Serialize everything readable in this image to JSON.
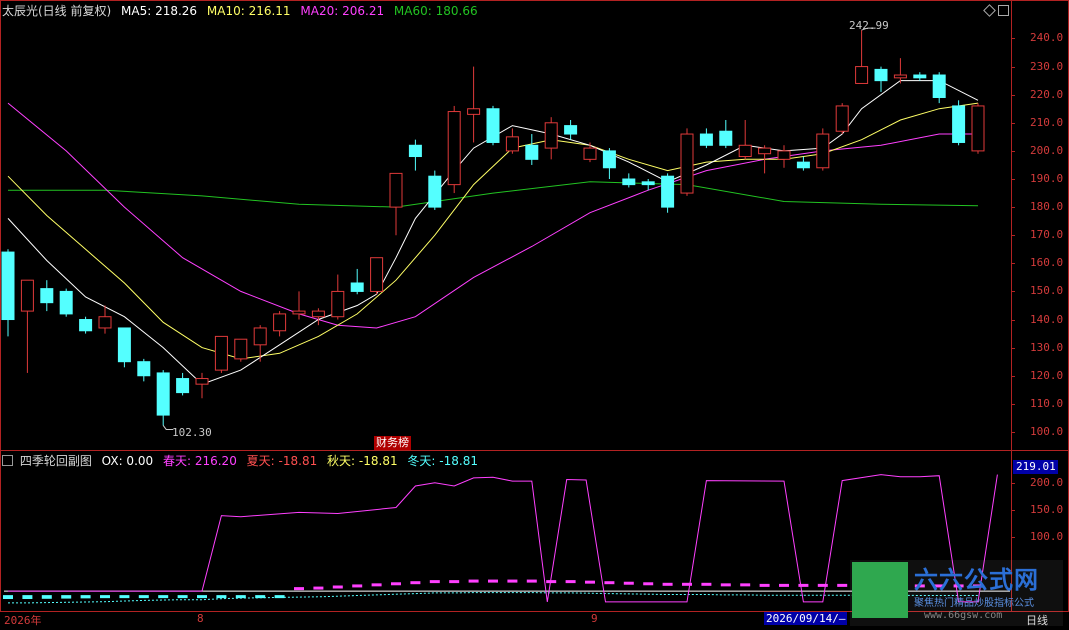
{
  "main_header": {
    "title": "太辰光(日线 前复权)",
    "ma5": "MA5: 218.26",
    "ma10": "MA10: 216.11",
    "ma20": "MA20: 206.21",
    "ma60": "MA60: 180.66"
  },
  "colors": {
    "up": "#e03a3a",
    "down": "#54ffff",
    "ma5": "#ffffff",
    "ma10": "#ffff66",
    "ma20": "#ff40ff",
    "ma60": "#22c322",
    "axis": "#b22222"
  },
  "main_axis_labels": [
    "240.0",
    "230.0",
    "220.0",
    "210.0",
    "200.0",
    "190.0",
    "180.0",
    "170.0",
    "160.0",
    "150.0",
    "140.0",
    "130.0",
    "120.0",
    "110.0",
    "100.0"
  ],
  "annotations": {
    "high": "242.99",
    "low": "102.30",
    "news_tag": "财务榜"
  },
  "top_right_icons": [
    "diamond-icon",
    "square-icon"
  ],
  "sub_header": {
    "title": "四季轮回副图",
    "ox": "OX: 0.00",
    "spring": "春天: 216.20",
    "summer": "夏天: -18.81",
    "autumn": "秋天: -18.81",
    "winter": "冬天: -18.81"
  },
  "sub_axis_labels": [
    "200.0",
    "150.0",
    "100.0"
  ],
  "sub_current_value": "219.01",
  "x_axis": {
    "year": "2026年",
    "m1": "8",
    "m2": "9",
    "cursor_date": "2026/09/14/—",
    "period": "日线"
  },
  "watermark": {
    "brand": "六六公式网",
    "slogan": "聚焦热门精品炒股指标公式",
    "url": "www.66gsw.com"
  },
  "chart_data": {
    "type": "candlestick",
    "price_range": [
      95,
      248
    ],
    "candles": [
      {
        "o": 164,
        "c": 140,
        "h": 165,
        "l": 134
      },
      {
        "o": 143,
        "c": 154,
        "h": 154,
        "l": 121
      },
      {
        "o": 151,
        "c": 146,
        "h": 154,
        "l": 143
      },
      {
        "o": 150,
        "c": 142,
        "h": 151,
        "l": 141
      },
      {
        "o": 140,
        "c": 136,
        "h": 141,
        "l": 135
      },
      {
        "o": 137,
        "c": 141,
        "h": 145,
        "l": 135
      },
      {
        "o": 137,
        "c": 125,
        "h": 137,
        "l": 123
      },
      {
        "o": 125,
        "c": 120,
        "h": 126,
        "l": 118
      },
      {
        "o": 121,
        "c": 106,
        "h": 122,
        "l": 102.3
      },
      {
        "o": 119,
        "c": 114,
        "h": 121,
        "l": 113
      },
      {
        "o": 117,
        "c": 119,
        "h": 121,
        "l": 112
      },
      {
        "o": 122,
        "c": 134,
        "h": 134,
        "l": 121
      },
      {
        "o": 126,
        "c": 133,
        "h": 133,
        "l": 125
      },
      {
        "o": 131,
        "c": 137,
        "h": 138,
        "l": 125
      },
      {
        "o": 136,
        "c": 142,
        "h": 143,
        "l": 134
      },
      {
        "o": 142,
        "c": 143,
        "h": 150,
        "l": 140
      },
      {
        "o": 141,
        "c": 143,
        "h": 144,
        "l": 138
      },
      {
        "o": 141,
        "c": 150,
        "h": 156,
        "l": 140
      },
      {
        "o": 153,
        "c": 150,
        "h": 158,
        "l": 149
      },
      {
        "o": 150,
        "c": 162,
        "h": 162,
        "l": 149
      },
      {
        "o": 180,
        "c": 192,
        "h": 192,
        "l": 170
      },
      {
        "o": 202,
        "c": 198,
        "h": 204,
        "l": 193
      },
      {
        "o": 191,
        "c": 180,
        "h": 193,
        "l": 179
      },
      {
        "o": 188,
        "c": 214,
        "h": 216,
        "l": 185
      },
      {
        "o": 213,
        "c": 215,
        "h": 230,
        "l": 203
      },
      {
        "o": 215,
        "c": 203,
        "h": 216,
        "l": 202
      },
      {
        "o": 200,
        "c": 205,
        "h": 208,
        "l": 199
      },
      {
        "o": 202,
        "c": 197,
        "h": 206,
        "l": 195
      },
      {
        "o": 201,
        "c": 210,
        "h": 212,
        "l": 197
      },
      {
        "o": 209,
        "c": 206,
        "h": 211,
        "l": 204
      },
      {
        "o": 197,
        "c": 201,
        "h": 203,
        "l": 196
      },
      {
        "o": 200,
        "c": 194,
        "h": 201,
        "l": 190
      },
      {
        "o": 190,
        "c": 188,
        "h": 192,
        "l": 187
      },
      {
        "o": 189,
        "c": 188,
        "h": 190,
        "l": 186
      },
      {
        "o": 191,
        "c": 180,
        "h": 192,
        "l": 178
      },
      {
        "o": 185,
        "c": 206,
        "h": 208,
        "l": 184
      },
      {
        "o": 206,
        "c": 202,
        "h": 208,
        "l": 201
      },
      {
        "o": 207,
        "c": 202,
        "h": 211,
        "l": 201
      },
      {
        "o": 198,
        "c": 202,
        "h": 211,
        "l": 197
      },
      {
        "o": 199,
        "c": 201,
        "h": 202,
        "l": 192
      },
      {
        "o": 197,
        "c": 200,
        "h": 202,
        "l": 194
      },
      {
        "o": 196,
        "c": 194,
        "h": 198,
        "l": 193
      },
      {
        "o": 194,
        "c": 206,
        "h": 208,
        "l": 193
      },
      {
        "o": 207,
        "c": 216,
        "h": 217,
        "l": 206
      },
      {
        "o": 224,
        "c": 230,
        "h": 242.99,
        "l": 224
      },
      {
        "o": 229,
        "c": 225,
        "h": 230,
        "l": 221
      },
      {
        "o": 226,
        "c": 227,
        "h": 233,
        "l": 224
      },
      {
        "o": 227,
        "c": 226,
        "h": 228,
        "l": 225
      },
      {
        "o": 227,
        "c": 219,
        "h": 228,
        "l": 217
      },
      {
        "o": 216,
        "c": 203,
        "h": 218,
        "l": 202
      },
      {
        "o": 200,
        "c": 216,
        "h": 217,
        "l": 199
      }
    ],
    "ma5": [
      {
        "i": 0,
        "v": 176
      },
      {
        "i": 2,
        "v": 161
      },
      {
        "i": 4,
        "v": 148
      },
      {
        "i": 6,
        "v": 141
      },
      {
        "i": 8,
        "v": 130
      },
      {
        "i": 10,
        "v": 117
      },
      {
        "i": 12,
        "v": 122
      },
      {
        "i": 14,
        "v": 131
      },
      {
        "i": 16,
        "v": 140
      },
      {
        "i": 18,
        "v": 145
      },
      {
        "i": 19,
        "v": 149
      },
      {
        "i": 20,
        "v": 162
      },
      {
        "i": 21,
        "v": 176
      },
      {
        "i": 23,
        "v": 193
      },
      {
        "i": 24,
        "v": 201
      },
      {
        "i": 26,
        "v": 209
      },
      {
        "i": 28,
        "v": 206
      },
      {
        "i": 30,
        "v": 202
      },
      {
        "i": 32,
        "v": 196
      },
      {
        "i": 34,
        "v": 189
      },
      {
        "i": 36,
        "v": 195
      },
      {
        "i": 38,
        "v": 202
      },
      {
        "i": 40,
        "v": 200
      },
      {
        "i": 42,
        "v": 201
      },
      {
        "i": 43,
        "v": 206
      },
      {
        "i": 44,
        "v": 215
      },
      {
        "i": 46,
        "v": 225
      },
      {
        "i": 48,
        "v": 225
      },
      {
        "i": 50,
        "v": 218
      }
    ],
    "ma10": [
      {
        "i": 0,
        "v": 191
      },
      {
        "i": 2,
        "v": 177
      },
      {
        "i": 4,
        "v": 165
      },
      {
        "i": 6,
        "v": 153
      },
      {
        "i": 8,
        "v": 139
      },
      {
        "i": 10,
        "v": 130
      },
      {
        "i": 12,
        "v": 126
      },
      {
        "i": 14,
        "v": 128
      },
      {
        "i": 16,
        "v": 134
      },
      {
        "i": 18,
        "v": 142
      },
      {
        "i": 20,
        "v": 154
      },
      {
        "i": 22,
        "v": 170
      },
      {
        "i": 24,
        "v": 188
      },
      {
        "i": 26,
        "v": 201
      },
      {
        "i": 28,
        "v": 204
      },
      {
        "i": 30,
        "v": 202
      },
      {
        "i": 32,
        "v": 197
      },
      {
        "i": 34,
        "v": 193
      },
      {
        "i": 36,
        "v": 196
      },
      {
        "i": 38,
        "v": 197
      },
      {
        "i": 40,
        "v": 197
      },
      {
        "i": 42,
        "v": 199
      },
      {
        "i": 44,
        "v": 204
      },
      {
        "i": 46,
        "v": 211
      },
      {
        "i": 48,
        "v": 215
      },
      {
        "i": 50,
        "v": 217
      }
    ],
    "ma20": [
      {
        "i": 0,
        "v": 217
      },
      {
        "i": 3,
        "v": 200
      },
      {
        "i": 6,
        "v": 180
      },
      {
        "i": 9,
        "v": 162
      },
      {
        "i": 12,
        "v": 150
      },
      {
        "i": 15,
        "v": 142
      },
      {
        "i": 17,
        "v": 138
      },
      {
        "i": 19,
        "v": 137
      },
      {
        "i": 21,
        "v": 141
      },
      {
        "i": 24,
        "v": 155
      },
      {
        "i": 27,
        "v": 166
      },
      {
        "i": 30,
        "v": 178
      },
      {
        "i": 33,
        "v": 186
      },
      {
        "i": 36,
        "v": 193
      },
      {
        "i": 39,
        "v": 197
      },
      {
        "i": 42,
        "v": 200
      },
      {
        "i": 45,
        "v": 202
      },
      {
        "i": 48,
        "v": 206
      },
      {
        "i": 50,
        "v": 206
      }
    ],
    "ma60": [
      {
        "i": 0,
        "v": 186
      },
      {
        "i": 5,
        "v": 186
      },
      {
        "i": 10,
        "v": 184
      },
      {
        "i": 15,
        "v": 181
      },
      {
        "i": 20,
        "v": 180
      },
      {
        "i": 25,
        "v": 185
      },
      {
        "i": 30,
        "v": 189
      },
      {
        "i": 35,
        "v": 188
      },
      {
        "i": 40,
        "v": 182
      },
      {
        "i": 45,
        "v": 181
      },
      {
        "i": 50,
        "v": 180.5
      }
    ],
    "sub": {
      "range": [
        -35,
        232
      ],
      "spring": [
        {
          "i": 0,
          "v": 0
        },
        {
          "i": 10,
          "v": 0
        },
        {
          "i": 11,
          "v": 140
        },
        {
          "i": 12,
          "v": 138
        },
        {
          "i": 15,
          "v": 146
        },
        {
          "i": 17,
          "v": 144
        },
        {
          "i": 20,
          "v": 155
        },
        {
          "i": 21,
          "v": 195
        },
        {
          "i": 22,
          "v": 201
        },
        {
          "i": 23,
          "v": 195
        },
        {
          "i": 24,
          "v": 210
        },
        {
          "i": 25,
          "v": 211
        },
        {
          "i": 26,
          "v": 204
        },
        {
          "i": 27,
          "v": 204
        },
        {
          "i": 27.8,
          "v": -20
        },
        {
          "i": 28.8,
          "v": 207
        },
        {
          "i": 29.8,
          "v": 206
        },
        {
          "i": 30.8,
          "v": -20
        },
        {
          "i": 35,
          "v": -20
        },
        {
          "i": 36,
          "v": 205
        },
        {
          "i": 40,
          "v": 204
        },
        {
          "i": 41,
          "v": -20
        },
        {
          "i": 42,
          "v": -20
        },
        {
          "i": 43,
          "v": 205
        },
        {
          "i": 45,
          "v": 216
        },
        {
          "i": 46,
          "v": 212
        },
        {
          "i": 47,
          "v": 212
        },
        {
          "i": 48,
          "v": 214
        },
        {
          "i": 49,
          "v": -20
        },
        {
          "i": 50,
          "v": -20
        },
        {
          "i": 51,
          "v": 216
        }
      ],
      "summer_bars": [
        -18,
        -18,
        -17,
        -16,
        -15,
        -14,
        -12,
        -10,
        -9,
        -8,
        -8,
        -5,
        -3,
        -2,
        -1,
        0,
        1,
        3,
        5,
        7,
        9,
        11,
        13,
        13,
        14,
        14,
        14,
        14,
        13,
        13,
        12,
        11,
        10,
        9,
        8,
        8,
        8,
        7,
        7,
        6,
        6,
        6,
        6,
        6,
        6,
        6,
        6,
        5,
        5,
        5,
        5
      ]
    }
  }
}
